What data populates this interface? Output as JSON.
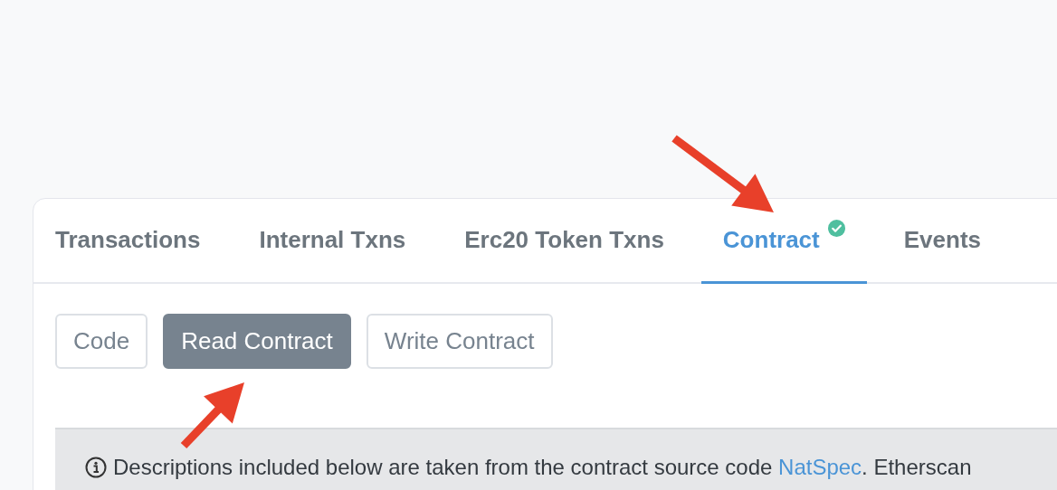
{
  "tabs": [
    {
      "label": "Transactions",
      "selected": false,
      "verified": false
    },
    {
      "label": "Internal Txns",
      "selected": false,
      "verified": false
    },
    {
      "label": "Erc20 Token Txns",
      "selected": false,
      "verified": false
    },
    {
      "label": "Contract",
      "selected": true,
      "verified": true
    },
    {
      "label": "Events",
      "selected": false,
      "verified": false
    }
  ],
  "sub_buttons": [
    {
      "label": "Code",
      "selected": false
    },
    {
      "label": "Read Contract",
      "selected": true
    },
    {
      "label": "Write Contract",
      "selected": false
    }
  ],
  "notice": {
    "text_before": "Descriptions included below are taken from the contract source code ",
    "link": "NatSpec",
    "text_after": ". Etherscan"
  }
}
